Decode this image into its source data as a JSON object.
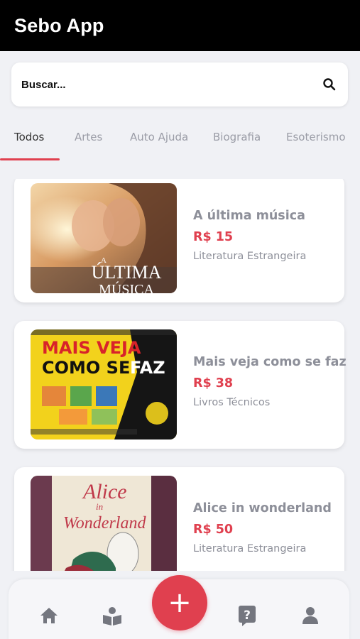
{
  "app": {
    "title": "Sebo App"
  },
  "search": {
    "placeholder": "Buscar..."
  },
  "tabs": [
    {
      "label": "Todos",
      "active": true
    },
    {
      "label": "Artes",
      "active": false
    },
    {
      "label": "Auto Ajuda",
      "active": false
    },
    {
      "label": "Biografia",
      "active": false
    },
    {
      "label": "Esoterismo",
      "active": false
    }
  ],
  "books": [
    {
      "title": "A última música",
      "price": "R$ 15",
      "category": "Literatura Estrangeira",
      "cover_text": [
        "A",
        "ÚLTIMA",
        "MÚSICA"
      ]
    },
    {
      "title": "Mais veja como se faz",
      "price": "R$ 38",
      "category": "Livros Técnicos",
      "cover_text": [
        "MAIS VEJA",
        "COMO SE",
        "FAZ"
      ]
    },
    {
      "title": "Alice in wonderland",
      "price": "R$ 50",
      "category": "Literatura Estrangeira",
      "cover_text": [
        "Alice",
        "in",
        "Wonderland"
      ]
    }
  ],
  "fab": {
    "label": "+"
  },
  "nav": {
    "icons": [
      "home-icon",
      "book-reader-icon",
      "add-icon",
      "question-icon",
      "user-icon"
    ]
  },
  "colors": {
    "accent": "#e0404f",
    "header": "#000000",
    "background": "#f0f1f5",
    "muted_text": "#8d8f99"
  }
}
